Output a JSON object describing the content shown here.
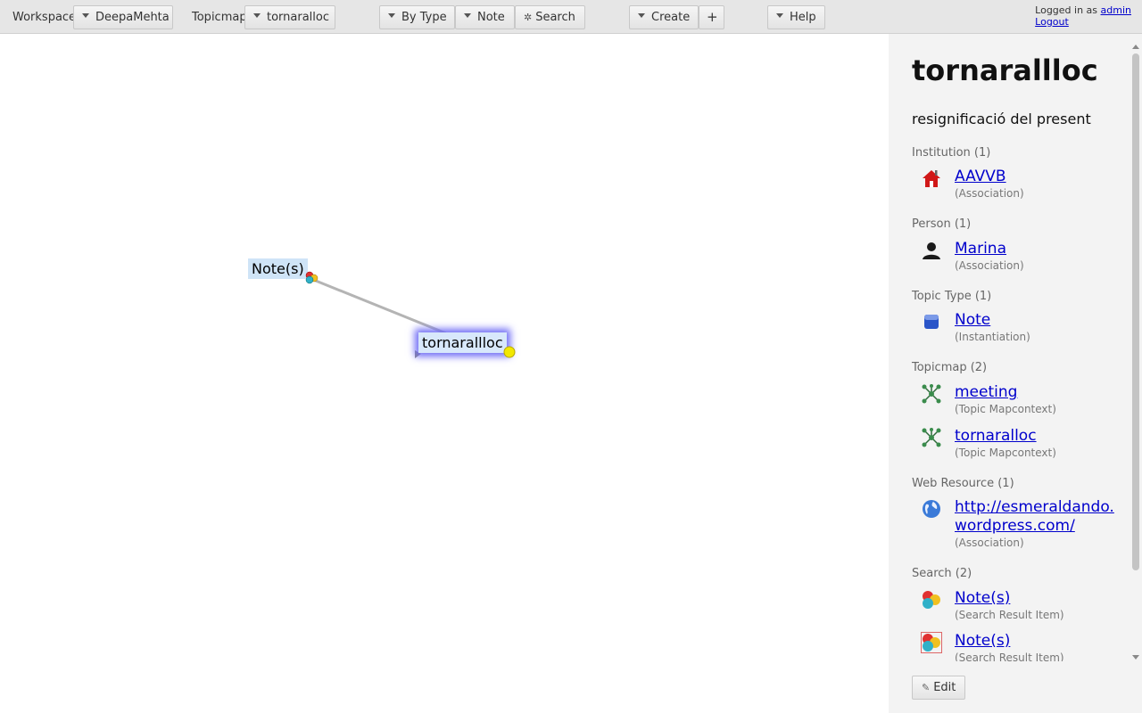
{
  "toolbar": {
    "workspace_label": "Workspace",
    "workspace_value": "DeepaMehta",
    "topicmap_label": "Topicmap",
    "topicmap_value": "tornaralloc",
    "by_type_label": "By Type",
    "note_label": "Note",
    "search_label": "Search",
    "create_label": "Create",
    "add_label": "+",
    "help_label": "Help"
  },
  "login": {
    "prefix": "Logged in as",
    "user": "admin",
    "logout": "Logout"
  },
  "canvas": {
    "nodes": {
      "notes": "Note(s)",
      "main": "tornarallloc"
    }
  },
  "panel": {
    "title": "tornarallloc",
    "subtitle": "resignificació del present",
    "groups": [
      {
        "head": "Institution (1)",
        "items": [
          {
            "icon": "house-icon",
            "link": "AAVVB",
            "sub": "(Association)"
          }
        ]
      },
      {
        "head": "Person (1)",
        "items": [
          {
            "icon": "person-icon",
            "link": "Marina",
            "sub": "(Association)"
          }
        ]
      },
      {
        "head": "Topic Type (1)",
        "items": [
          {
            "icon": "note-type-icon",
            "link": "Note",
            "sub": "(Instantiation)"
          }
        ]
      },
      {
        "head": "Topicmap (2)",
        "items": [
          {
            "icon": "topicmap-icon",
            "link": "meeting",
            "sub": "(Topic Mapcontext)"
          },
          {
            "icon": "topicmap-icon",
            "link": "tornaralloc",
            "sub": "(Topic Mapcontext)"
          }
        ]
      },
      {
        "head": "Web Resource (1)",
        "items": [
          {
            "icon": "globe-icon",
            "link": "http://esmeraldando.wordpress.com/",
            "sub": "(Association)"
          }
        ]
      },
      {
        "head": "Search (2)",
        "items": [
          {
            "icon": "search-result-icon",
            "link": "Note(s)",
            "sub": "(Search Result Item)"
          },
          {
            "icon": "search-result-icon",
            "link": "Note(s)",
            "sub": "(Search Result Item)"
          }
        ]
      }
    ],
    "edit_label": "Edit"
  },
  "colors": {
    "toolbar_bg": "#e6e6e6",
    "panel_bg": "#f3f3f3",
    "link": "#0000cc",
    "node_highlight": "#6f6cf5"
  }
}
